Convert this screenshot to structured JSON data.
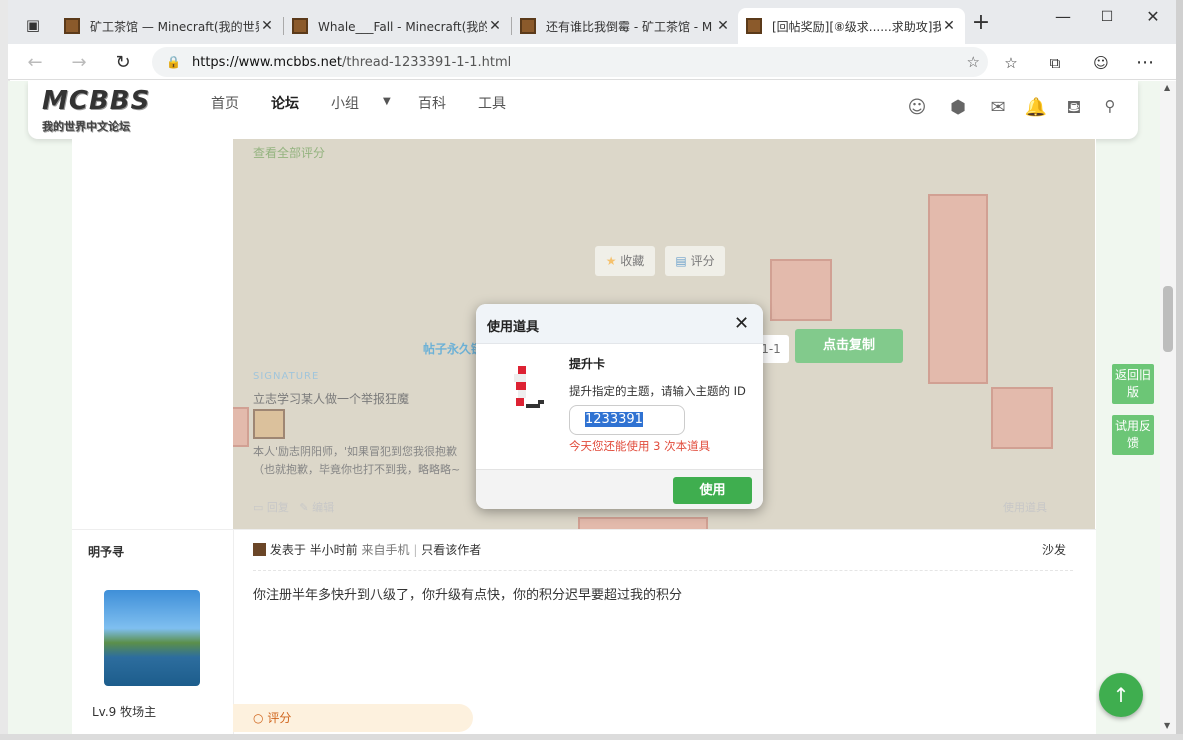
{
  "browser": {
    "tabs": [
      {
        "title": "矿工茶馆 — Minecraft(我的世界"
      },
      {
        "title": "Whale___Fall - Minecraft(我的世"
      },
      {
        "title": "还有谁比我倒霉 - 矿工茶馆 - M"
      },
      {
        "title": "[回帖奖励][⑧级求......求助攻]我"
      }
    ],
    "new_tab": "+",
    "url_host": "https://www.mcbbs.net",
    "url_path": "/thread-1233391-1-1.html"
  },
  "site": {
    "logo": "MCBBS",
    "logo_sub": "我的世界中文论坛",
    "nav": [
      "首页",
      "论坛",
      "小组",
      "百科",
      "工具"
    ]
  },
  "post": {
    "view_all_ratings": "查看全部评分",
    "favorite": "收藏",
    "rate": "评分",
    "post_link": "帖子永久链",
    "copy_fragment": "1-1",
    "copy_button": "点击复制",
    "signature_tag": "SIGNATURE",
    "signature_line": "立志学习某人做一个举报狂魔",
    "signature_more": "本人'励志阴阳师，'如果冒犯到您我很抱歉",
    "signature_more2": "（也就抱歉，毕竟你也打不到我，略略略~",
    "action_reply": "回复",
    "action_edit": "编辑",
    "action_use_item": "使用道具"
  },
  "reply": {
    "author": "明予寻",
    "level": "Lv.9 牧场主",
    "posted": "发表于 半小时前",
    "from_mobile": "来自手机",
    "author_only": "只看该作者",
    "floor": "沙发",
    "message": "你注册半年多快升到八级了，你升级有点快，你的积分迟早要超过我的积分",
    "rating": "评分"
  },
  "side": {
    "old_version": "返回旧版",
    "feedback": "试用反馈",
    "to_top": "↑"
  },
  "modal": {
    "title": "使用道具",
    "close": "✕",
    "item_name": "提升卡",
    "item_desc": "提升指定的主题，请输入主题的 ID",
    "thread_id": "1233391",
    "remaining_prefix": "今天您还能使用",
    "remaining_count": "3",
    "remaining_suffix": "次本道具",
    "use_button": "使用"
  }
}
